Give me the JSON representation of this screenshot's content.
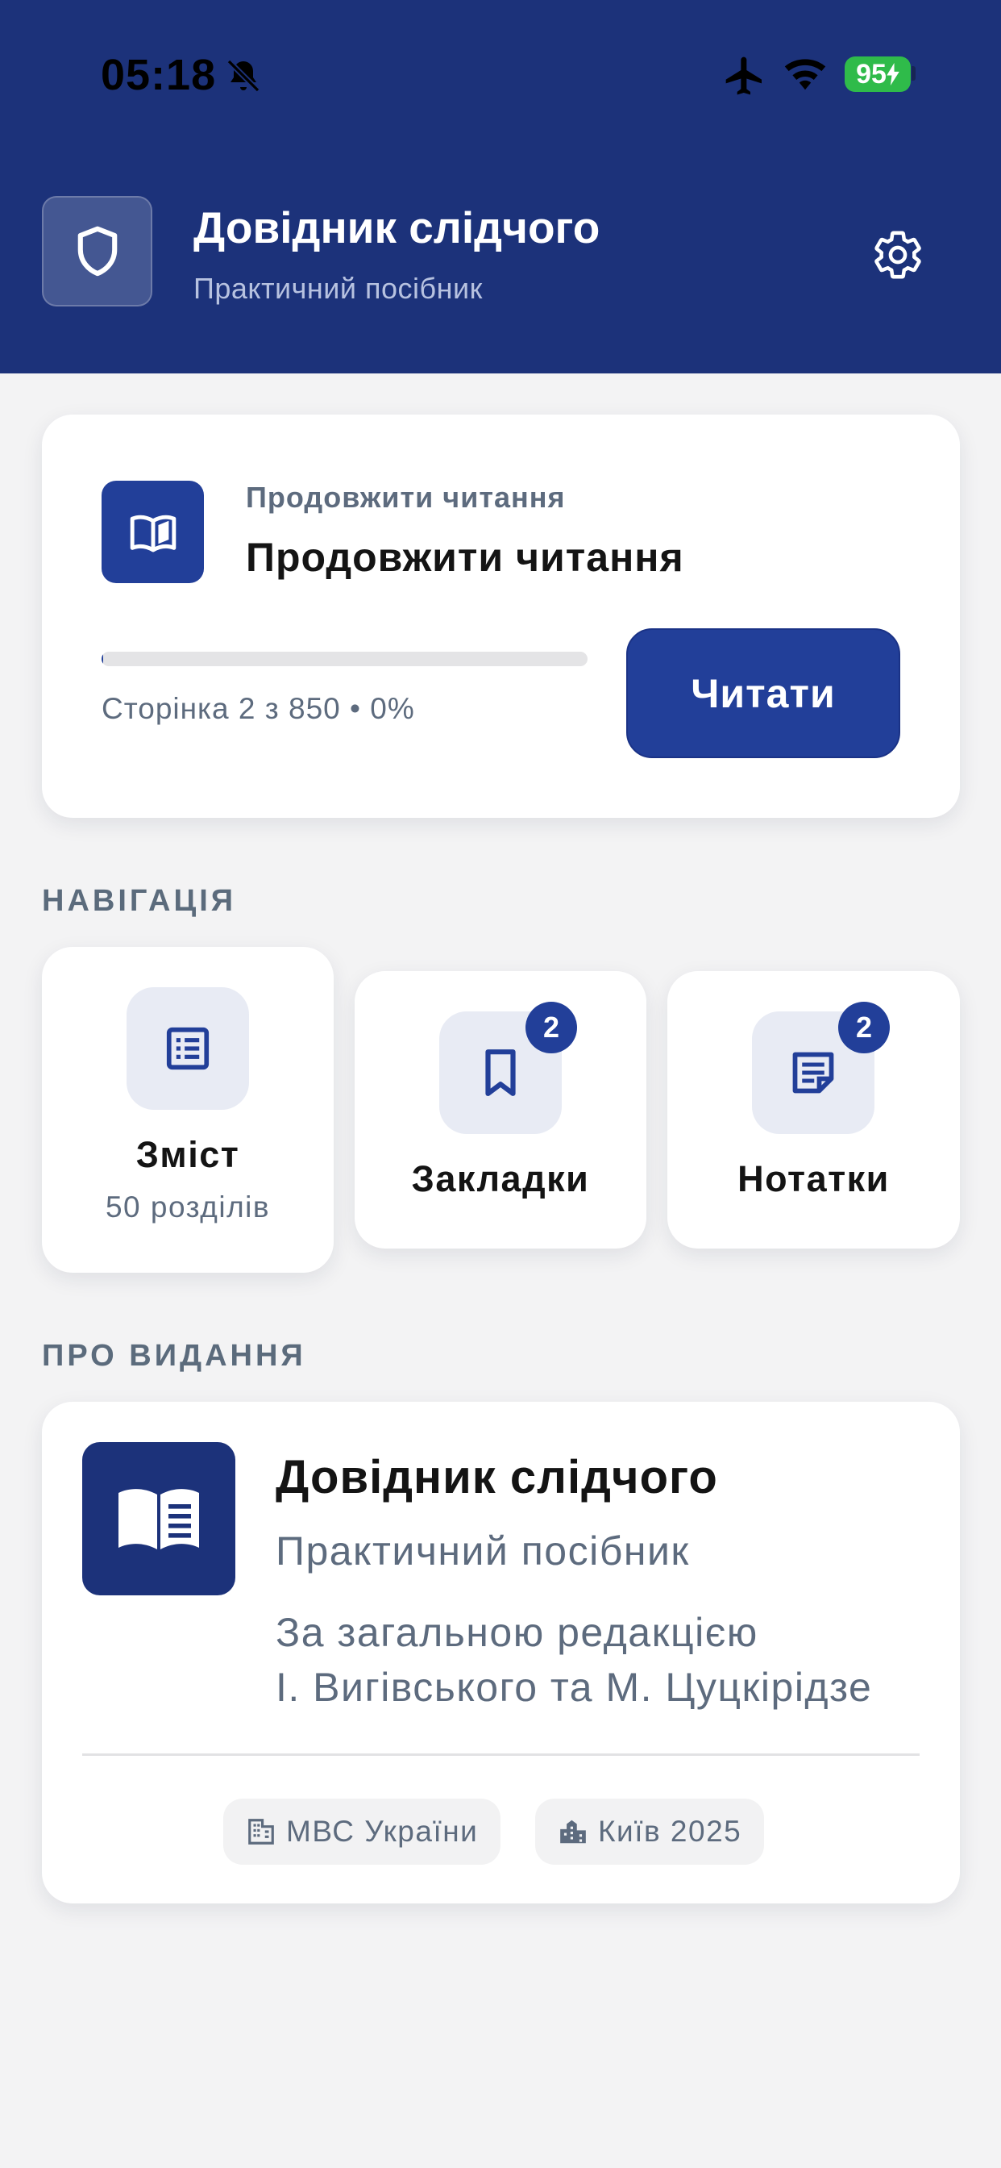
{
  "status_bar": {
    "time": "05:18",
    "battery": "95",
    "icons": [
      "bell-slash-icon",
      "airplane-icon",
      "wifi-icon",
      "battery-charging-icon"
    ]
  },
  "header": {
    "title": "Довідник слідчого",
    "subtitle": "Практичний посібник",
    "logo_icon": "shield-icon",
    "settings_icon": "gear-icon",
    "background_color": "#1c327a"
  },
  "continue_card": {
    "kicker": "Продовжити читання",
    "title": "Продовжити читання",
    "progress_text": "Сторінка 2 з 850 • 0%",
    "progress_percent": 0,
    "read_button": "Читати",
    "icon": "open-book-icon"
  },
  "navigation": {
    "section_label": "НАВІГАЦІЯ",
    "items": [
      {
        "label": "Зміст",
        "sub": "50 розділів",
        "icon": "list-icon",
        "badge": ""
      },
      {
        "label": "Закладки",
        "sub": "",
        "icon": "bookmark-icon",
        "badge": "2"
      },
      {
        "label": "Нотатки",
        "sub": "",
        "icon": "note-icon",
        "badge": "2"
      }
    ]
  },
  "about": {
    "section_label": "ПРО ВИДАННЯ",
    "title": "Довідник слідчого",
    "subtitle": "Практичний посібник",
    "editor_line1": "За загальною редакцією",
    "editor_line2": "І. Вигівського та М. Цуцкірідзе",
    "chips": [
      {
        "label": "МВС України",
        "icon": "building-icon"
      },
      {
        "label": "Київ 2025",
        "icon": "city-icon"
      }
    ]
  },
  "colors": {
    "accent": "#223f99",
    "header": "#1c327a",
    "muted_text": "#5d6b7e",
    "background": "#f3f3f4"
  }
}
